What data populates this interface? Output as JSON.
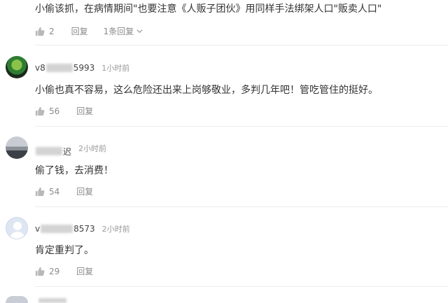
{
  "comments": [
    {
      "text": "小偷该抓，在病情期间\"也要注意《人贩子团伙》用同样手法绑架人口\"贩卖人口\"",
      "likes": "2",
      "reply_label": "回复",
      "replies_label": "1条回复"
    },
    {
      "user_prefix": "v8",
      "user_suffix": "5993",
      "time": "1小时前",
      "text": "小偷也真不容易，这么危险还出来上岗够敬业，多判几年吧！管吃管住的挺好。",
      "likes": "56",
      "reply_label": "回复"
    },
    {
      "user_prefix": "",
      "user_suffix": "迟",
      "time": "2小时前",
      "text": "偷了钱，去消费！",
      "likes": "54",
      "reply_label": "回复"
    },
    {
      "user_prefix": "v",
      "user_suffix": "8573",
      "time": "2小时前",
      "text": "肯定重判了。",
      "likes": "29",
      "reply_label": "回复"
    }
  ]
}
